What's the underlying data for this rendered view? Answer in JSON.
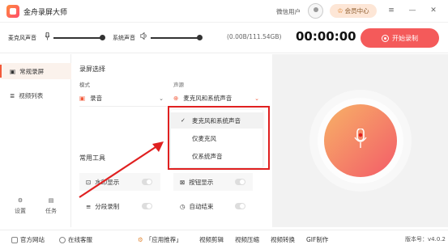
{
  "app": {
    "title": "金舟录屏大师"
  },
  "header": {
    "user_label": "微信用户",
    "member_label": "会员中心",
    "crown_icon": "♔"
  },
  "audio": {
    "mic_label": "麦克风声音",
    "system_label": "系统声音",
    "storage": "(0.00B/111.54GB)",
    "timer": "00:00:00",
    "record_label": "开始录制"
  },
  "sidebar": {
    "items": [
      {
        "label": "常规录屏",
        "icon": "▣"
      },
      {
        "label": "视频列表",
        "icon": "≣"
      }
    ],
    "settings_label": "设置",
    "tasks_label": "任务"
  },
  "main": {
    "section_title": "录屏选择",
    "mode_label": "模式",
    "mode_value": "录音",
    "source_label": "声源",
    "source_value": "麦克风和系统声音",
    "dropdown": {
      "items": [
        "麦克风和系统声音",
        "仅麦克风",
        "仅系统声音"
      ],
      "selected_index": 0,
      "check": "✓"
    },
    "tools_title": "常用工具",
    "tools": [
      {
        "label": "水印显示",
        "icon": "⊡",
        "enabled": false
      },
      {
        "label": "按钮显示",
        "icon": "⊠",
        "enabled": false
      },
      {
        "label": "分段录制",
        "icon": "≡",
        "enabled": false
      },
      {
        "label": "自动结束",
        "icon": "◷",
        "enabled": false
      }
    ]
  },
  "footer": {
    "official_site": "官方网站",
    "online_service": "在线客服",
    "recommend": "「应用推荐」",
    "links": [
      "视频剪辑",
      "视频压缩",
      "视频转换",
      "GIF制作"
    ],
    "version": "版本号：v4.0.2"
  },
  "colors": {
    "accent": "#f45a5a",
    "highlight_box": "#e02020",
    "orb_start": "#f7b267",
    "orb_end": "#f35b68"
  }
}
